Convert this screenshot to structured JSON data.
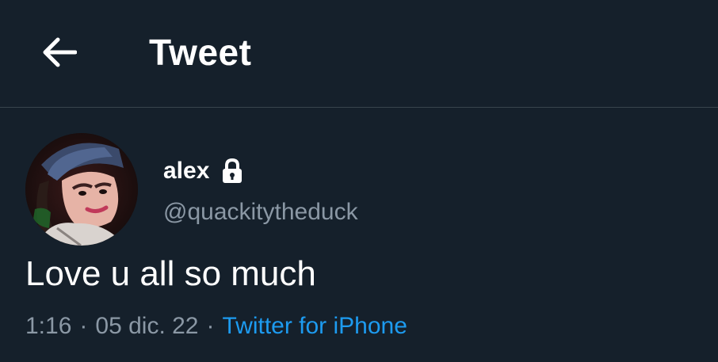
{
  "header": {
    "title": "Tweet",
    "back_icon": "arrow-left-icon"
  },
  "author": {
    "display_name": "alex",
    "handle": "@quackitytheduck",
    "protected_icon": "lock-icon",
    "avatar_icon": "avatar-photo"
  },
  "tweet": {
    "text": "Love u all so much",
    "time": "1:16",
    "separator": "·",
    "date": "05 dic. 22",
    "source": "Twitter for iPhone"
  },
  "colors": {
    "background": "#15202b",
    "text_primary": "#ffffff",
    "text_secondary": "#8b98a5",
    "link": "#1d9bf0",
    "divider": "#38444d"
  }
}
